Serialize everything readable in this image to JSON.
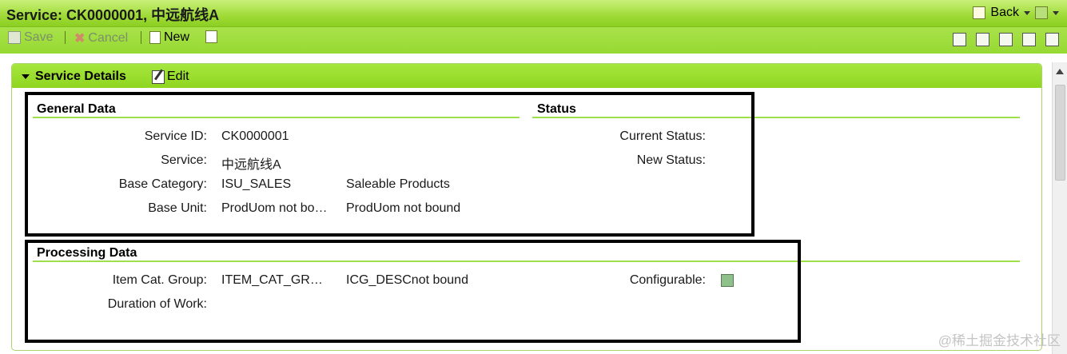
{
  "window": {
    "title": "Service: CK0000001, 中远航线A",
    "back_label": "Back"
  },
  "toolbar": {
    "save_label": "Save",
    "cancel_label": "Cancel",
    "new_label": "New",
    "right_icons": [
      "settings-icon",
      "new-window-icon",
      "document-icon",
      "tools-icon",
      "print-icon"
    ]
  },
  "panel": {
    "title": "Service Details",
    "edit_label": "Edit"
  },
  "general_data": {
    "heading": "General Data",
    "rows": [
      {
        "label": "Service ID:",
        "value": "CK0000001",
        "desc": ""
      },
      {
        "label": "Service:",
        "value": "中远航线A",
        "desc": ""
      },
      {
        "label": "Base Category:",
        "value": "ISU_SALES",
        "desc": "Saleable Products"
      },
      {
        "label": "Base Unit:",
        "value": "ProdUom not bo…",
        "desc": "ProdUom not bound"
      }
    ]
  },
  "status": {
    "heading": "Status",
    "current_label": "Current Status:",
    "new_label": "New Status:"
  },
  "processing_data": {
    "heading": "Processing Data",
    "item_cat_label": "Item Cat. Group:",
    "item_cat_value": "ITEM_CAT_GR…",
    "item_cat_desc": "ICG_DESCnot bound",
    "duration_label": "Duration of Work:",
    "configurable_label": "Configurable:"
  },
  "watermark": "@稀土掘金技术社区",
  "colors": {
    "accent": "#9ee04a",
    "header": "#a6e63e"
  }
}
